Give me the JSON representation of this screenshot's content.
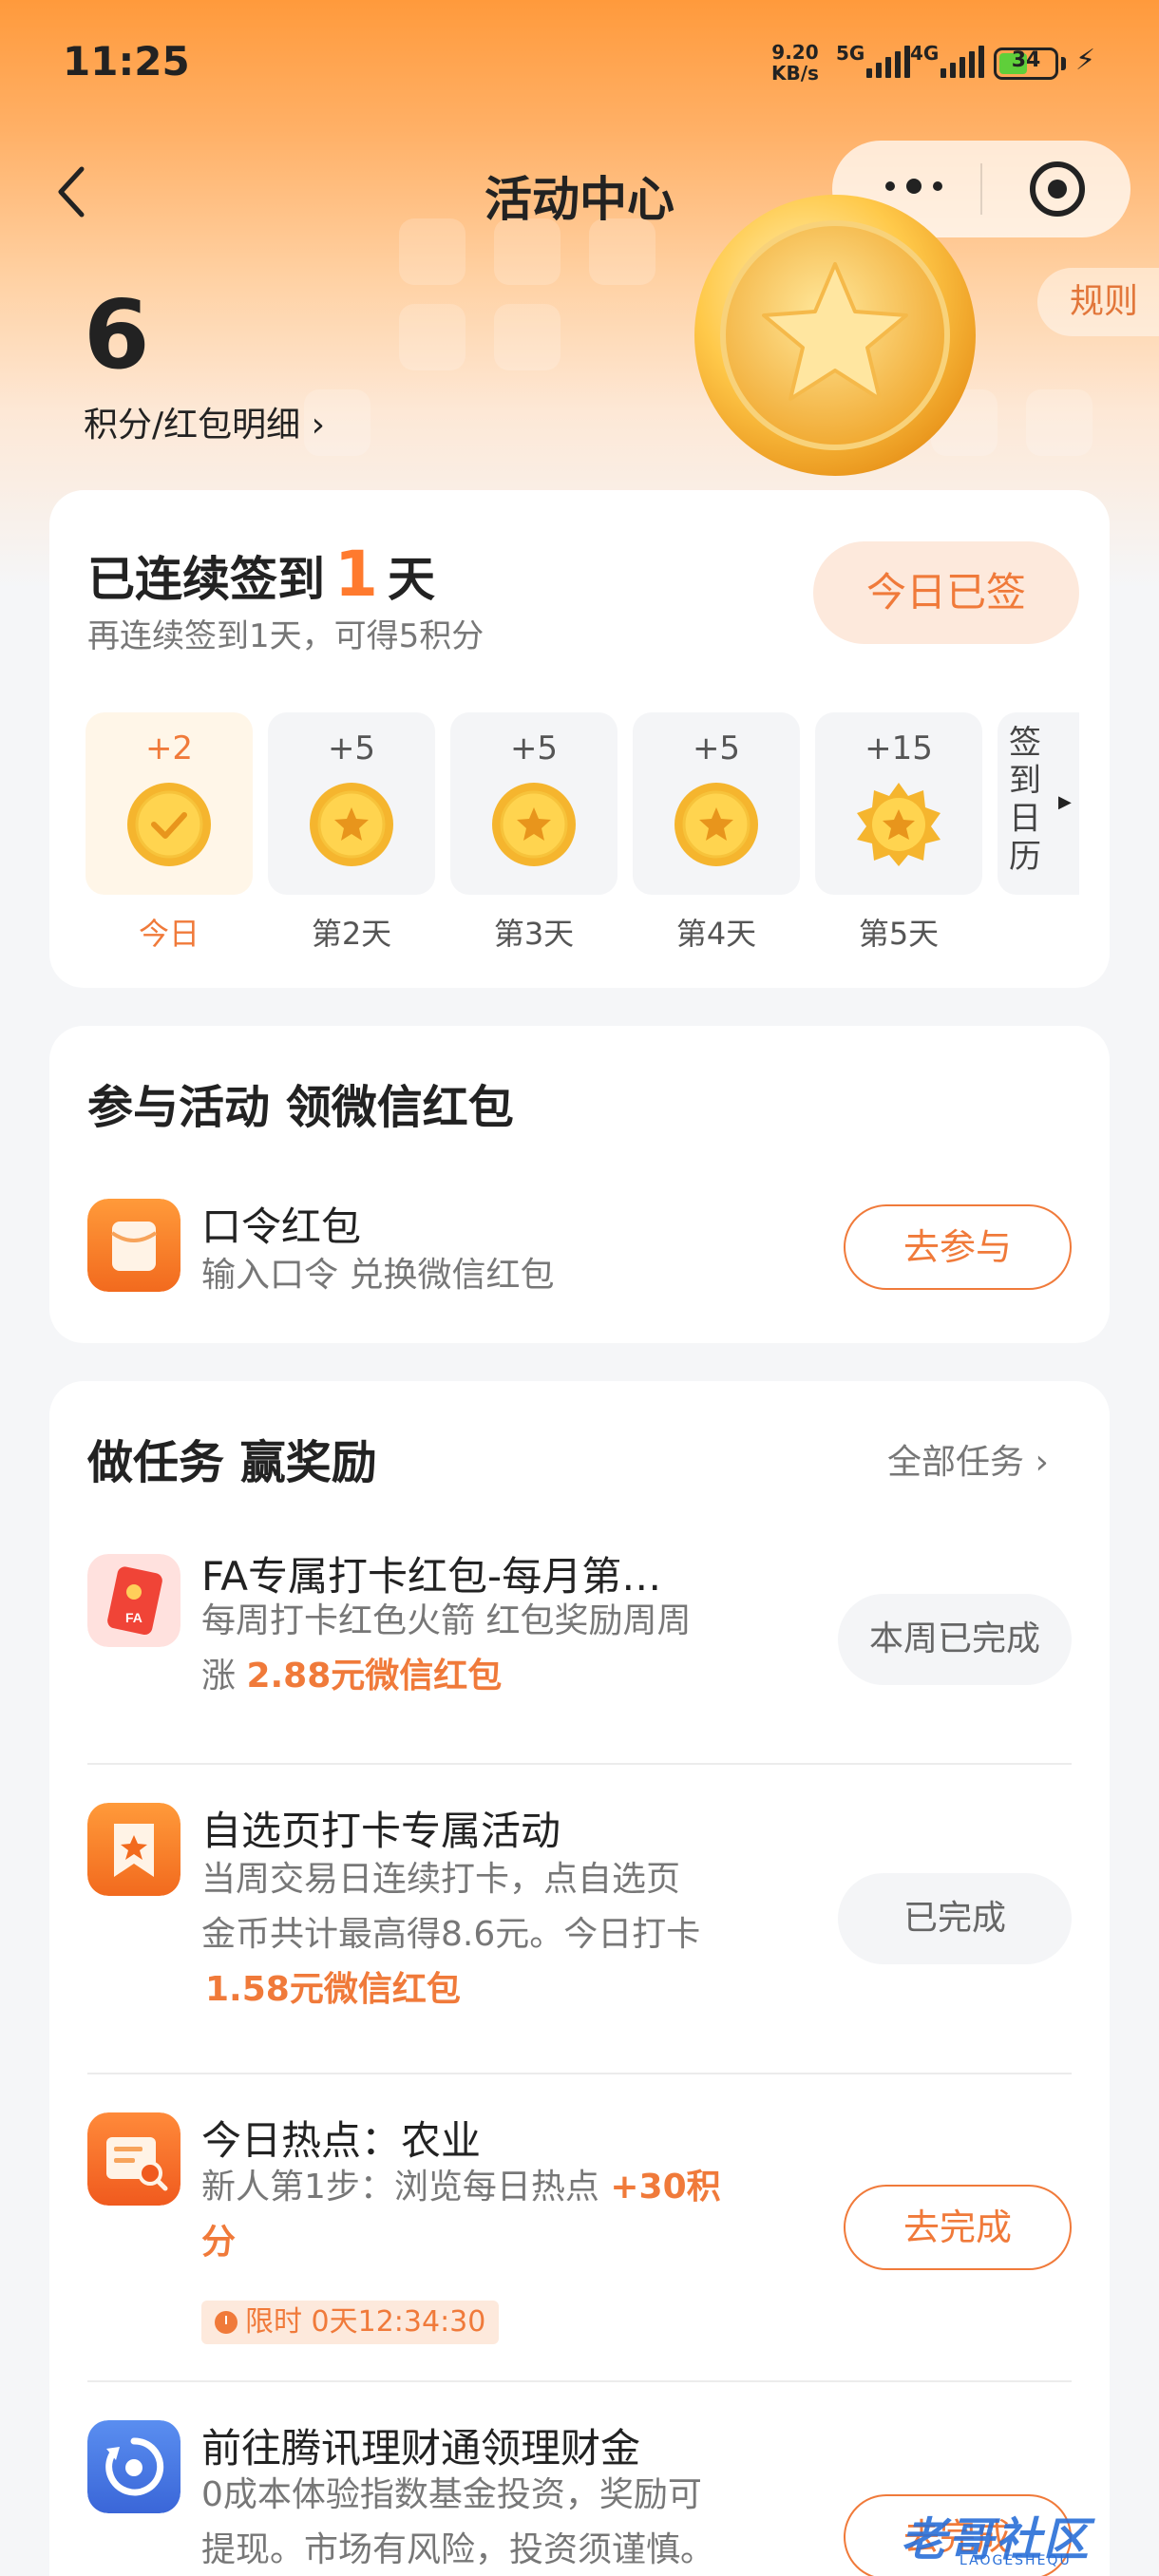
{
  "status_bar": {
    "time": "11:25",
    "net_speed_value": "9.20",
    "net_speed_unit": "KB/s",
    "sig1": "5G",
    "sig2": "4G",
    "battery": "34",
    "battery_level": 0.34
  },
  "nav": {
    "title": "活动中心",
    "back_icon": "chevron-left-icon",
    "more_icon": "more-dots-icon",
    "close_icon": "target-icon"
  },
  "header": {
    "rules": "规则",
    "points": "6",
    "points_link": "积分/红包明细 ›"
  },
  "checkin": {
    "streak_prefix": "已连续签到",
    "streak_days": "1",
    "streak_suffix": "天",
    "subtitle": "再连续签到1天，可得5积分",
    "signed_button": "今日已签",
    "days": [
      {
        "points": "+2",
        "label": "今日",
        "state": "signed"
      },
      {
        "points": "+5",
        "label": "第2天",
        "state": "pending"
      },
      {
        "points": "+5",
        "label": "第3天",
        "state": "pending"
      },
      {
        "points": "+5",
        "label": "第4天",
        "state": "pending"
      },
      {
        "points": "+15",
        "label": "第5天",
        "state": "bonus"
      }
    ],
    "calendar": "签到日历"
  },
  "activity": {
    "title": "参与活动 领微信红包",
    "item": {
      "title": "口令红包",
      "desc": "输入口令 兑换微信红包",
      "button": "去参与"
    }
  },
  "tasks": {
    "title": "做任务 赢奖励",
    "all": "全部任务 ›",
    "items": [
      {
        "title": "FA专属打卡红包-每月第…",
        "desc_line1": "每周打卡红色火箭 红包奖励周周",
        "desc_line2_prefix": "涨 ",
        "desc_highlight": "2.88元微信红包",
        "button": "本周已完成"
      },
      {
        "title": "自选页打卡专属活动",
        "desc_line1": "当周交易日连续打卡，点自选页",
        "desc_line2": "金币共计最高得8.6元。今日打卡",
        "desc_highlight": "1.58元微信红包",
        "button": "已完成"
      },
      {
        "title": "今日热点：农业",
        "desc_line1_prefix": "新人第1步：浏览每日热点 ",
        "desc_highlight_a": "+30积",
        "desc_highlight_b": "分",
        "timer": "限时 0天12:34:30",
        "button": "去完成"
      },
      {
        "title": "前往腾讯理财通领理财金",
        "desc_line1": "0成本体验指数基金投资，奖励可",
        "desc_line2": "提现。市场有风险，投资须谨慎。",
        "button": "去完成"
      }
    ]
  },
  "watermark": {
    "text": "老哥社区",
    "sub": "LAOGESHEQU"
  },
  "colors": {
    "accent": "#f07a3a",
    "hero_top": "#ff9a3c",
    "page_bg": "#f5f6f8"
  }
}
